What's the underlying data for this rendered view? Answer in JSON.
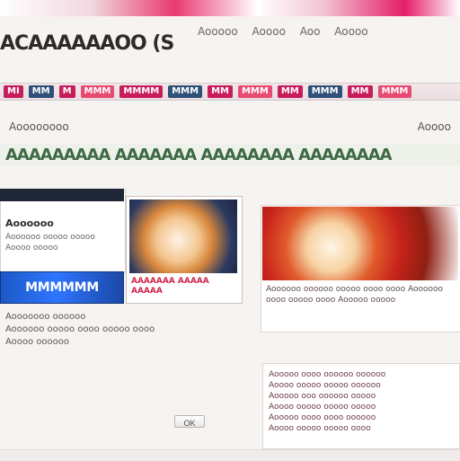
{
  "header": {
    "site_title": "ACAAAAAAOO (S",
    "links": [
      "Aooooo",
      "Aoooo",
      "Aoo",
      "Aoooo"
    ]
  },
  "nav": {
    "items": [
      {
        "label": "MI"
      },
      {
        "label": "MM"
      },
      {
        "label": "M"
      },
      {
        "label": "MMM"
      },
      {
        "label": "MMMM"
      },
      {
        "label": "MMM"
      },
      {
        "label": "MM"
      },
      {
        "label": "MMM"
      },
      {
        "label": "MM"
      },
      {
        "label": "MMM"
      },
      {
        "label": "MM"
      },
      {
        "label": "MMM"
      }
    ]
  },
  "subbar": {
    "left": "Aoooooooo",
    "right": "Aoooo"
  },
  "ticker": {
    "text": "AAAAAAAAA AAAAAAA AAAAAAAA AAAAAAAA"
  },
  "content": {
    "left_panel": {
      "title": "Aoooooo",
      "desc": "Aoooooo ooooo ooooo\nAoooo ooooo"
    },
    "promo": {
      "text": "MMMMMM"
    },
    "left_meta": {
      "lines": [
        "Aooooooo oooooo",
        "Aoooooo ooooo oooo ooooo oooo",
        "Aoooo oooooo"
      ]
    },
    "featured": {
      "caption": "AAAAAAA AAAAA AAAAA"
    },
    "right_feature": {
      "title": "Aoooooo oooooo ooooo oooo oooo\nAoooooo oooo ooooo oooo\nAooooo ooooo"
    },
    "articles": [
      "Aooooo oooo oooooo oooooo",
      "Aoooo ooooo ooooo oooooo",
      "Aooooo ooo oooooo ooooo",
      "Aoooo ooooo ooooo ooooo",
      "Aooooo oooo oooo oooooo",
      "Aoooo ooooo ooooo oooo"
    ],
    "small_button": {
      "label": "OK"
    }
  },
  "colors": {
    "brand_pink": "#e83a72",
    "nav_blue": "#2f5078",
    "promo_blue": "#2f76ff",
    "ticker_green": "#3c6a43"
  }
}
